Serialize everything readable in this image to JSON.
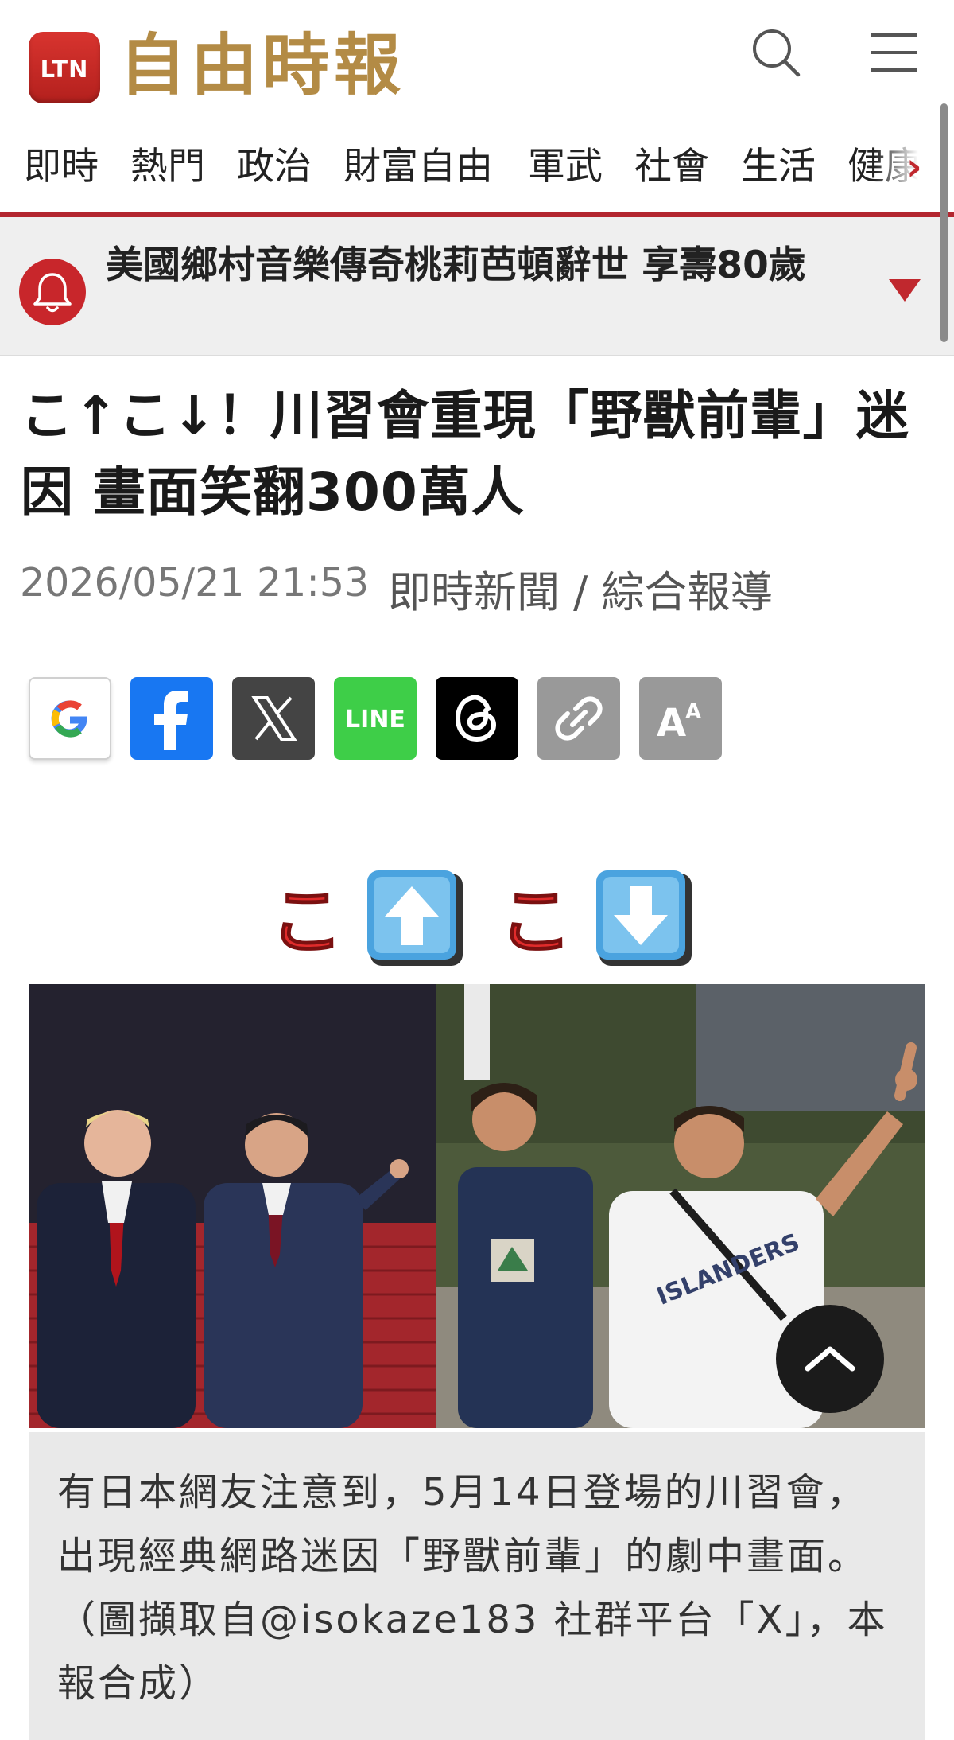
{
  "header": {
    "logo_badge": "LTN",
    "logo_text": "自由時報"
  },
  "nav": {
    "items": [
      "即時",
      "熱門",
      "政治",
      "財富自由",
      "軍武",
      "社會",
      "生活",
      "健康"
    ],
    "more_icon": "chevron-right-icon"
  },
  "breaking": {
    "icon": "bell-icon",
    "text": "美國鄉村音樂傳奇桃莉芭頓辭世 享壽80歲",
    "toggle_icon": "triangle-down-icon"
  },
  "article": {
    "headline": "こ↑こ↓！川習會重現「野獸前輩」迷因 畫面笑翻300萬人",
    "date": "2026/05/21 21:53",
    "category": "即時新聞 / 綜合報導"
  },
  "share": [
    {
      "name": "google",
      "icon": "google-icon"
    },
    {
      "name": "facebook",
      "icon": "facebook-icon"
    },
    {
      "name": "x",
      "icon": "x-icon"
    },
    {
      "name": "line",
      "icon": "line-icon",
      "label": "LINE"
    },
    {
      "name": "threads",
      "icon": "threads-icon"
    },
    {
      "name": "copy-link",
      "icon": "link-icon"
    },
    {
      "name": "font-size",
      "icon": "font-size-icon"
    }
  ],
  "figure": {
    "overlay_text": [
      "こ",
      "こ"
    ],
    "overlay_icons": [
      "arrow-up-emoji-icon",
      "arrow-down-emoji-icon"
    ],
    "shirt_text": "ISLANDERS",
    "caption": "有日本網友注意到，5月14日登場的川習會，出現經典網路迷因「野獸前輩」的劇中畫面。（圖擷取自@isokaze183 社群平台「X」，本報合成）"
  },
  "back_to_top_icon": "chevron-up-icon",
  "colors": {
    "brand_red": "#b3262f",
    "logo_gold": "#b38b45",
    "facebook": "#1877f2",
    "line": "#3ece48"
  }
}
